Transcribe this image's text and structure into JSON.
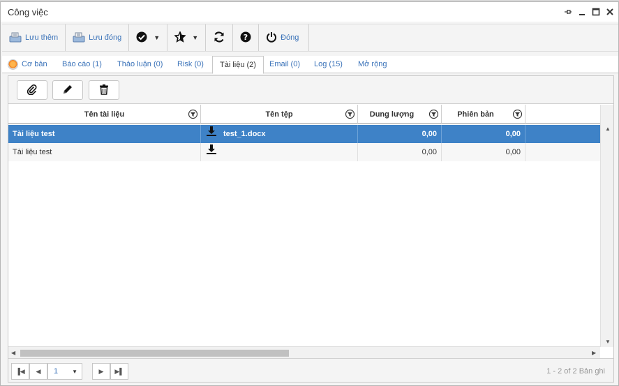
{
  "window": {
    "title": "Công việc"
  },
  "toolbar": {
    "save_new": "Lưu thêm",
    "save_close": "Lưu đóng",
    "close": "Đóng"
  },
  "tabs": [
    {
      "label": "Cơ bản"
    },
    {
      "label": "Báo cáo (1)"
    },
    {
      "label": "Thảo luận (0)"
    },
    {
      "label": "Risk (0)"
    },
    {
      "label": "Tài liệu (2)"
    },
    {
      "label": "Email (0)"
    },
    {
      "label": "Log (15)"
    },
    {
      "label": "Mở rộng"
    }
  ],
  "grid": {
    "columns": [
      "Tên tài liệu",
      "Tên tệp",
      "Dung lượng",
      "Phiên bản"
    ],
    "rows": [
      {
        "name": "Tài liệu test",
        "file": "test_1.docx",
        "size": "0,00",
        "version": "0,00"
      },
      {
        "name": "Tài liệu test",
        "file": "",
        "size": "0,00",
        "version": "0,00"
      }
    ]
  },
  "pager": {
    "page": "1",
    "info": "1 - 2 of 2 Bản ghi"
  },
  "colors": {
    "accent": "#3b73b9",
    "selected_row": "#3e82c7"
  }
}
